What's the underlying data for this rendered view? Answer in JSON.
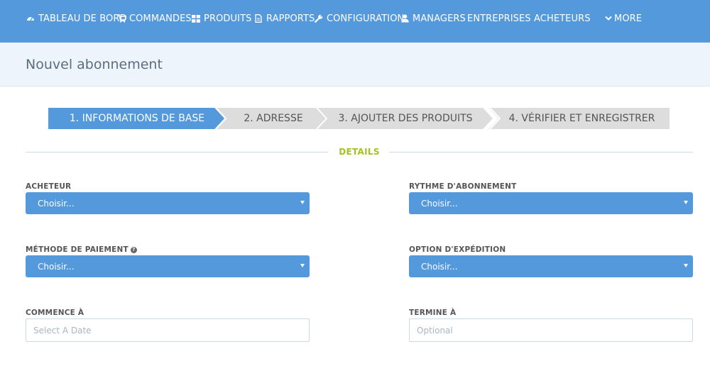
{
  "nav": {
    "items": [
      {
        "label": "TABLEAU DE BORD",
        "icon": "dashboard-icon"
      },
      {
        "label": "COMMANDES",
        "icon": "cart-icon"
      },
      {
        "label": "PRODUITS",
        "icon": "grid-icon"
      },
      {
        "label": "RAPPORTS",
        "icon": "document-icon"
      },
      {
        "label": "CONFIGURATION",
        "icon": "wrench-icon"
      },
      {
        "label": "MANAGERS",
        "icon": "user-icon"
      },
      {
        "label": "ENTREPRISES",
        "icon": ""
      },
      {
        "label": "ACHETEURS",
        "icon": ""
      },
      {
        "label": "MORE",
        "icon": "chevron-down-icon"
      }
    ]
  },
  "page": {
    "title": "Nouvel abonnement"
  },
  "wizard": {
    "steps": [
      {
        "label": "1. INFORMATIONS DE BASE",
        "active": true
      },
      {
        "label": "2. ADRESSE",
        "active": false
      },
      {
        "label": "3. AJOUTER DES PRODUITS",
        "active": false
      },
      {
        "label": "4. VÉRIFIER ET ENREGISTRER",
        "active": false
      }
    ]
  },
  "section": {
    "title": "DETAILS"
  },
  "form": {
    "buyer": {
      "label": "ACHETEUR",
      "value": "Choisir..."
    },
    "rhythm": {
      "label": "RYTHME D'ABONNEMENT",
      "value": "Choisir..."
    },
    "payment": {
      "label": "MÉTHODE DE PAIEMENT",
      "value": "Choisir...",
      "help_icon": "question-icon"
    },
    "shipping": {
      "label": "OPTION D'EXPÉDITION",
      "value": "Choisir..."
    },
    "start": {
      "label": "COMMENCE À",
      "value": "",
      "placeholder": "Select A Date"
    },
    "end": {
      "label": "TERMINE À",
      "value": "",
      "placeholder": "Optional"
    }
  },
  "colors": {
    "primary": "#5599dd",
    "header_band": "#eef4fb",
    "section_accent": "#a3c21f",
    "step_inactive": "#dddddd"
  }
}
